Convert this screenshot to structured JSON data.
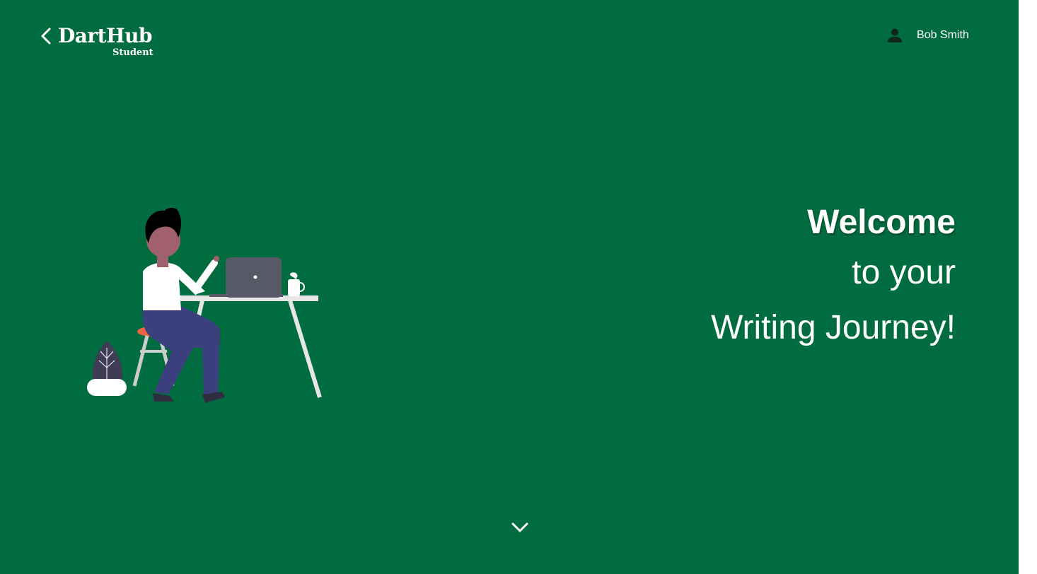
{
  "header": {
    "brand_name": "DartHub",
    "brand_sub": "Student",
    "back_icon": "chevron-left-icon",
    "user_icon": "person-icon",
    "user_name": "Bob Smith"
  },
  "hero": {
    "line1": "Welcome",
    "line2": "to your",
    "line3": "Writing Journey!"
  },
  "footer": {
    "scroll_icon": "chevron-down-icon"
  },
  "colors": {
    "background": "#006c3f",
    "text": "#ffffff",
    "laptop": "#575a66",
    "pants": "#3b3f7e",
    "stool": "#f26445",
    "skin": "#a0616a",
    "plant": "#3f3d56"
  }
}
